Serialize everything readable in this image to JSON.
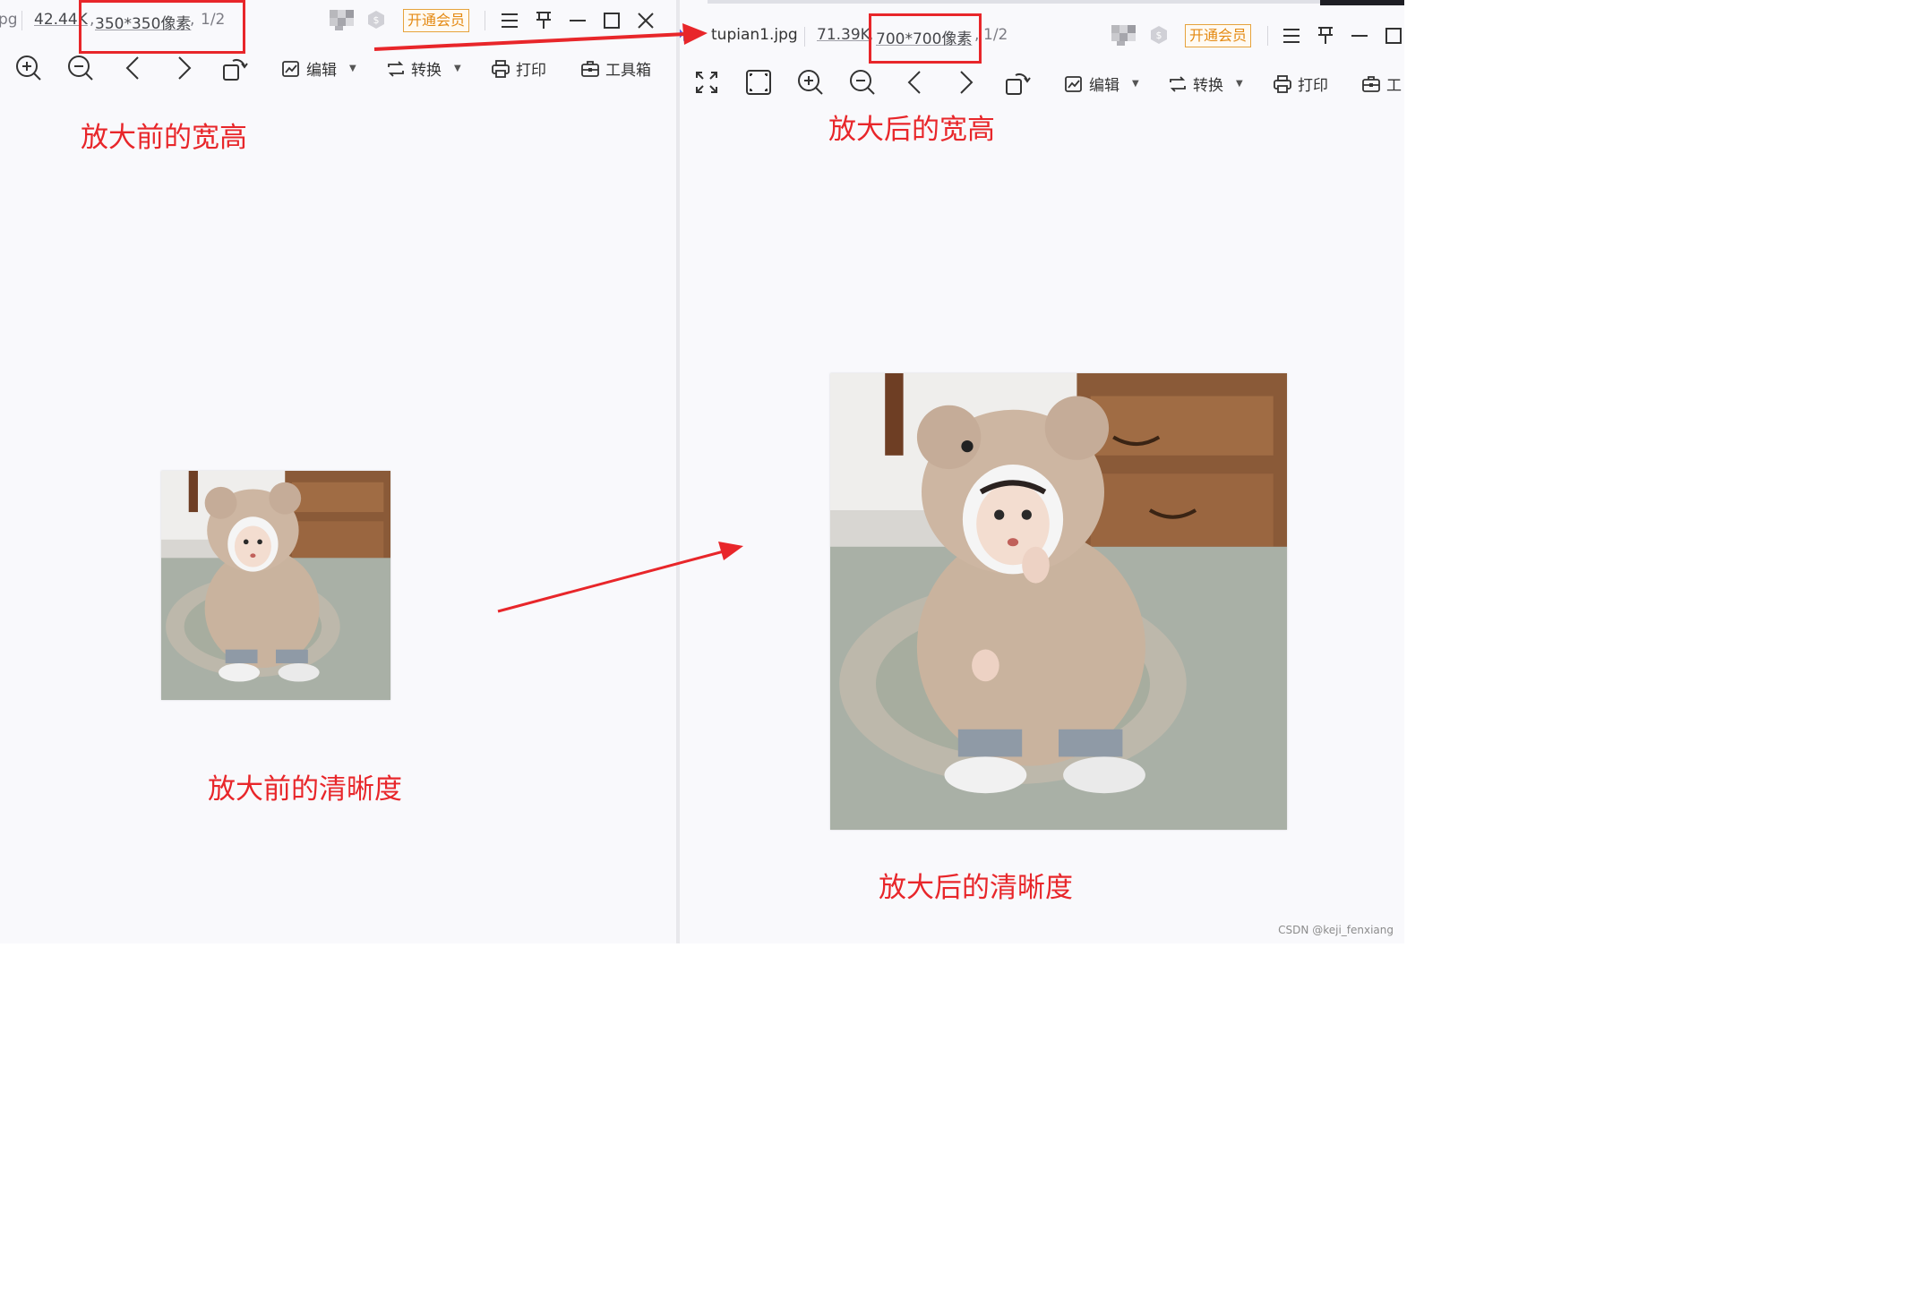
{
  "left_viewer": {
    "filename_fragment": "pg",
    "file_size": "42.44K",
    "dimensions": "350*350像素",
    "page_indicator": "1/2",
    "vip_button": "开通会员",
    "toolbar": {
      "edit_label": "编辑",
      "convert_label": "转换",
      "print_label": "打印",
      "toolbox_label": "工具箱"
    },
    "annotations": {
      "size_note": "放大前的宽高",
      "clarity_note": "放大前的清晰度"
    }
  },
  "right_viewer": {
    "filename": "tupian1.jpg",
    "file_size": "71.39K",
    "dimensions": "700*700像素",
    "page_indicator": "1/2",
    "vip_button": "开通会员",
    "toolbar": {
      "edit_label": "编辑",
      "convert_label": "转换",
      "print_label": "打印",
      "toolbox_label_partial": "工"
    },
    "annotations": {
      "size_note": "放大后的宽高",
      "clarity_note": "放大后的清晰度"
    }
  },
  "watermark": "CSDN @keji_fenxiang",
  "colors": {
    "annotation_red": "#e8262a",
    "vip_orange": "#e48a13",
    "viewer_background": "#f9f9fc"
  },
  "icons": {
    "zoom_in": "zoom-in-icon",
    "zoom_out": "zoom-out-icon",
    "previous": "chevron-left-icon",
    "next": "chevron-right-icon",
    "rotate": "rotate-icon",
    "fullscreen": "fullscreen-icon",
    "fit": "fit-window-icon",
    "edit": "edit-icon",
    "convert": "convert-icon",
    "print": "print-icon",
    "toolbox": "toolbox-icon",
    "menu": "menu-icon",
    "pin": "pin-icon",
    "minimize": "minimize-icon",
    "maximize": "maximize-icon",
    "close": "close-icon"
  }
}
